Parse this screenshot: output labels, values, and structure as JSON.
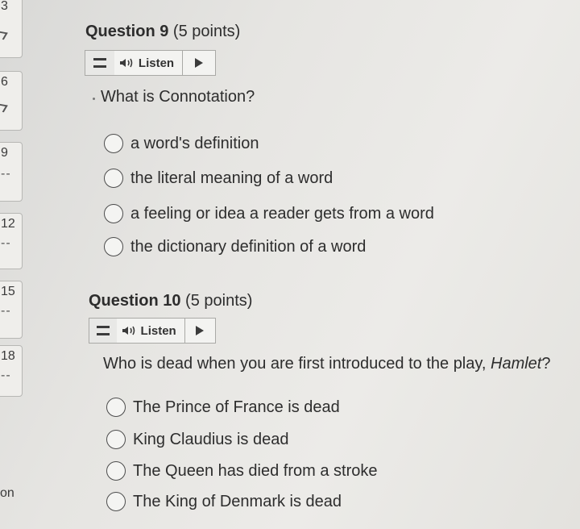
{
  "sidebar": {
    "cards": [
      {
        "num": "3",
        "mark": "check"
      },
      {
        "num": "6",
        "mark": "check"
      },
      {
        "num": "9",
        "mark": "--"
      },
      {
        "num": "12",
        "mark": "--"
      },
      {
        "num": "15",
        "mark": "--"
      },
      {
        "num": "18",
        "mark": "--"
      }
    ],
    "tail_label": "on"
  },
  "questions": [
    {
      "number_label": "Question 9",
      "points_label": "(5 points)",
      "listen_label": "Listen",
      "prompt": "What is Connotation?",
      "options": [
        "a word's definition",
        "the literal meaning of a word",
        "a feeling or idea a reader gets from a word",
        "the dictionary definition of a word"
      ]
    },
    {
      "number_label": "Question 10",
      "points_label": "(5 points)",
      "listen_label": "Listen",
      "prompt": "Who is dead when you are first introduced to the play, ",
      "prompt_italic": "Hamlet",
      "prompt_end": "?",
      "options": [
        "The Prince of France is dead",
        "King Claudius is dead",
        "The Queen has died from a stroke",
        "The King of Denmark is dead"
      ]
    }
  ]
}
